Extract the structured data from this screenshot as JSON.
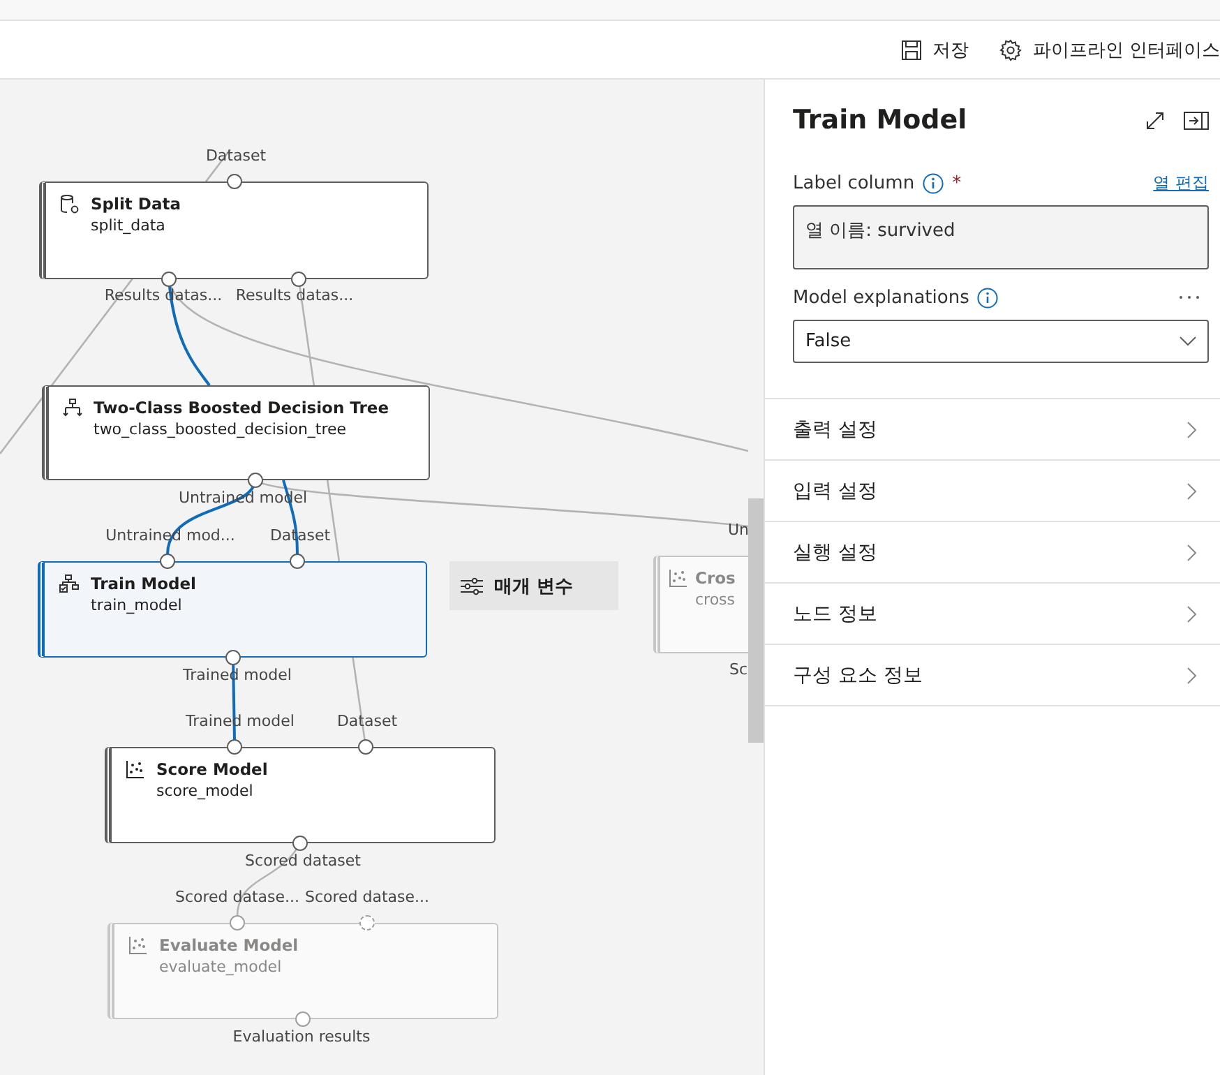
{
  "toolbar": {
    "buttons": [
      {
        "label": "저장",
        "kind": "save"
      },
      {
        "label": "파이프라인 인터페이스",
        "kind": "settings"
      }
    ]
  },
  "canvas": {
    "nodes": [
      {
        "title": "Split Data",
        "name": "split_data",
        "kind": "data",
        "selected": false,
        "disabled": false,
        "inputs": [
          {
            "label": "Dataset",
            "connected": true
          }
        ],
        "outputs": [
          {
            "label": "Results datas...",
            "connected": true
          },
          {
            "label": "Results datas...",
            "connected": true
          }
        ]
      },
      {
        "title": "Two-Class Boosted Decision Tree",
        "name": "two_class_boosted_decision_tree",
        "kind": "tree",
        "selected": false,
        "disabled": false,
        "outputs": [
          {
            "label": "Untrained model",
            "connected": true
          }
        ]
      },
      {
        "title": "Train Model",
        "name": "train_model",
        "kind": "train",
        "selected": true,
        "disabled": false,
        "inputs": [
          {
            "label": "Untrained mod...",
            "connected": true
          },
          {
            "label": "Dataset",
            "connected": true
          }
        ],
        "outputs": [
          {
            "label": "Trained model",
            "connected": true
          }
        ]
      },
      {
        "title": "Score Model",
        "name": "score_model",
        "kind": "scatter",
        "selected": false,
        "disabled": false,
        "inputs": [
          {
            "label": "Trained model",
            "connected": true
          },
          {
            "label": "Dataset",
            "connected": true
          }
        ],
        "outputs": [
          {
            "label": "Scored dataset",
            "connected": true
          }
        ]
      },
      {
        "title": "Evaluate Model",
        "name": "evaluate_model",
        "kind": "scatter",
        "selected": false,
        "disabled": true,
        "inputs": [
          {
            "label": "Scored datase...",
            "connected": true
          },
          {
            "label": "Scored datase...",
            "connected": false
          }
        ],
        "outputs": [
          {
            "label": "Evaluation results",
            "connected": true
          }
        ]
      },
      {
        "title": "Cros",
        "name": "cross",
        "kind": "scatter",
        "selected": false,
        "disabled": true,
        "inputs": [
          {
            "label": "Un"
          }
        ],
        "outputs": [
          {
            "label": "Sc"
          }
        ]
      }
    ],
    "parameters_button": {
      "label": "매개 변수"
    }
  },
  "panel": {
    "title": "Train Model",
    "fields": [
      {
        "kind": "column",
        "label": "Label column",
        "required_mark": "*",
        "action": "열 편집",
        "value": "열 이름: survived"
      },
      {
        "kind": "dropdown",
        "label": "Model explanations",
        "value": "False"
      }
    ],
    "sections": [
      {
        "label": "출력 설정",
        "expanded": false
      },
      {
        "label": "입력 설정",
        "expanded": false
      },
      {
        "label": "실행 설정",
        "expanded": false
      },
      {
        "label": "노드 정보",
        "expanded": false
      },
      {
        "label": "구성 요소 정보",
        "expanded": false
      }
    ]
  }
}
